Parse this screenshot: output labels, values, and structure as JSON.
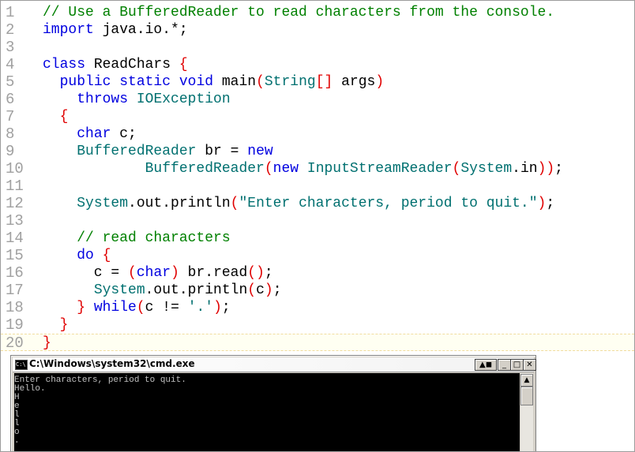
{
  "editor": {
    "lines": [
      {
        "n": "1",
        "tokens": [
          {
            "t": "// Use a BufferedReader to read characters from the console.",
            "c": "cm"
          }
        ]
      },
      {
        "n": "2",
        "tokens": [
          {
            "t": "import",
            "c": "kw"
          },
          {
            "t": " java.io.*;",
            "c": "df"
          }
        ]
      },
      {
        "n": "3",
        "tokens": []
      },
      {
        "n": "4",
        "tokens": [
          {
            "t": "class",
            "c": "kw"
          },
          {
            "t": " ReadChars ",
            "c": "df"
          },
          {
            "t": "{",
            "c": "pu"
          }
        ]
      },
      {
        "n": "5",
        "tokens": [
          {
            "t": "  ",
            "c": "df"
          },
          {
            "t": "public static void",
            "c": "kw"
          },
          {
            "t": " main",
            "c": "df"
          },
          {
            "t": "(",
            "c": "pu"
          },
          {
            "t": "String",
            "c": "ty"
          },
          {
            "t": "[]",
            "c": "pu"
          },
          {
            "t": " args",
            "c": "df"
          },
          {
            "t": ")",
            "c": "pu"
          }
        ]
      },
      {
        "n": "6",
        "tokens": [
          {
            "t": "    ",
            "c": "df"
          },
          {
            "t": "throws",
            "c": "kw"
          },
          {
            "t": " ",
            "c": "df"
          },
          {
            "t": "IOException",
            "c": "ty"
          }
        ]
      },
      {
        "n": "7",
        "tokens": [
          {
            "t": "  ",
            "c": "df"
          },
          {
            "t": "{",
            "c": "pu"
          }
        ]
      },
      {
        "n": "8",
        "tokens": [
          {
            "t": "    ",
            "c": "df"
          },
          {
            "t": "char",
            "c": "kw"
          },
          {
            "t": " c;",
            "c": "df"
          }
        ]
      },
      {
        "n": "9",
        "tokens": [
          {
            "t": "    ",
            "c": "df"
          },
          {
            "t": "BufferedReader",
            "c": "ty"
          },
          {
            "t": " br = ",
            "c": "df"
          },
          {
            "t": "new",
            "c": "kw"
          }
        ]
      },
      {
        "n": "10",
        "tokens": [
          {
            "t": "            ",
            "c": "df"
          },
          {
            "t": "BufferedReader",
            "c": "ty"
          },
          {
            "t": "(",
            "c": "pu"
          },
          {
            "t": "new",
            "c": "kw"
          },
          {
            "t": " ",
            "c": "df"
          },
          {
            "t": "InputStreamReader",
            "c": "ty"
          },
          {
            "t": "(",
            "c": "pu"
          },
          {
            "t": "System",
            "c": "ty"
          },
          {
            "t": ".in",
            "c": "df"
          },
          {
            "t": "))",
            "c": "pu"
          },
          {
            "t": ";",
            "c": "df"
          }
        ]
      },
      {
        "n": "11",
        "tokens": []
      },
      {
        "n": "12",
        "tokens": [
          {
            "t": "    ",
            "c": "df"
          },
          {
            "t": "System",
            "c": "ty"
          },
          {
            "t": ".out.println",
            "c": "df"
          },
          {
            "t": "(",
            "c": "pu"
          },
          {
            "t": "\"Enter characters, period to quit.\"",
            "c": "st"
          },
          {
            "t": ")",
            "c": "pu"
          },
          {
            "t": ";",
            "c": "df"
          }
        ]
      },
      {
        "n": "13",
        "tokens": []
      },
      {
        "n": "14",
        "tokens": [
          {
            "t": "    ",
            "c": "df"
          },
          {
            "t": "// read characters",
            "c": "cm"
          }
        ]
      },
      {
        "n": "15",
        "tokens": [
          {
            "t": "    ",
            "c": "df"
          },
          {
            "t": "do",
            "c": "kw"
          },
          {
            "t": " ",
            "c": "df"
          },
          {
            "t": "{",
            "c": "pu"
          }
        ]
      },
      {
        "n": "16",
        "tokens": [
          {
            "t": "      c = ",
            "c": "df"
          },
          {
            "t": "(",
            "c": "pu"
          },
          {
            "t": "char",
            "c": "kw"
          },
          {
            "t": ")",
            "c": "pu"
          },
          {
            "t": " br.read",
            "c": "df"
          },
          {
            "t": "()",
            "c": "pu"
          },
          {
            "t": ";",
            "c": "df"
          }
        ]
      },
      {
        "n": "17",
        "tokens": [
          {
            "t": "      ",
            "c": "df"
          },
          {
            "t": "System",
            "c": "ty"
          },
          {
            "t": ".out.println",
            "c": "df"
          },
          {
            "t": "(",
            "c": "pu"
          },
          {
            "t": "c",
            "c": "df"
          },
          {
            "t": ")",
            "c": "pu"
          },
          {
            "t": ";",
            "c": "df"
          }
        ]
      },
      {
        "n": "18",
        "tokens": [
          {
            "t": "    ",
            "c": "df"
          },
          {
            "t": "}",
            "c": "pu"
          },
          {
            "t": " ",
            "c": "df"
          },
          {
            "t": "while",
            "c": "kw"
          },
          {
            "t": "(",
            "c": "pu"
          },
          {
            "t": "c != ",
            "c": "df"
          },
          {
            "t": "'.'",
            "c": "st"
          },
          {
            "t": ")",
            "c": "pu"
          },
          {
            "t": ";",
            "c": "df"
          }
        ]
      },
      {
        "n": "19",
        "tokens": [
          {
            "t": "  ",
            "c": "df"
          },
          {
            "t": "}",
            "c": "pu"
          }
        ]
      },
      {
        "n": "20",
        "tokens": [
          {
            "t": "}",
            "c": "pu"
          }
        ]
      }
    ]
  },
  "console": {
    "title": "C:\\Windows\\system32\\cmd.exe",
    "icon_text": "C:\\",
    "buttons": {
      "scroll": "▲◼",
      "minimize": "_",
      "maximize": "□",
      "close": "✕"
    },
    "output_lines": [
      "Enter characters, period to quit.",
      "Hello.",
      "H",
      "e",
      "l",
      "l",
      "o",
      "."
    ],
    "scroll_up": "▲"
  }
}
